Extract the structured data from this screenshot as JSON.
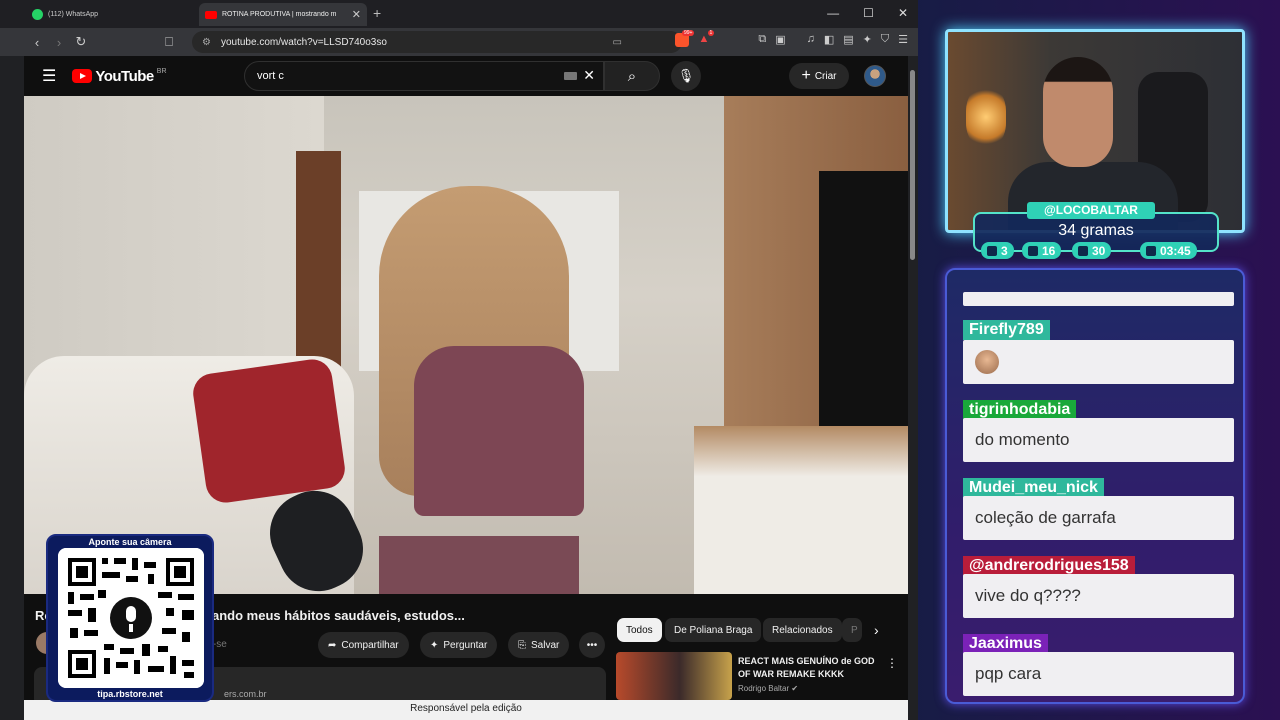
{
  "browser": {
    "tabs": [
      {
        "label": "(112) WhatsApp"
      },
      {
        "label": "ROTINA PRODUTIVA | mostrando m"
      }
    ],
    "url": "youtube.com/watch?v=LLSD740o3so",
    "status_text": "Responsável pela edição",
    "brave_badge": "99+",
    "alert_badge": "1"
  },
  "youtube": {
    "logo_text": "YouTube",
    "region": "BR",
    "search_value": "vort c",
    "create_label": "Criar",
    "video_title": "ando meus hábitos saudáveis, estudos...",
    "title_prefix": "Ro",
    "subscribe_faded": "er-se",
    "actions": {
      "share": "Compartilhar",
      "ask": "Perguntar",
      "save": "Salvar"
    },
    "description_url": "ers.com.br",
    "chips": [
      "Todos",
      "De Poliana Braga",
      "Relacionados",
      "P"
    ],
    "recommendation": {
      "title": "REACT MAIS GENUÍNO de GOD OF WAR REMAKE KKKK",
      "channel": "Rodrigo Baltar"
    }
  },
  "qr": {
    "top_text": "Aponte sua câmera",
    "bottom_text": "tipa.rbstore.net"
  },
  "stream": {
    "handle": "@LOCOBALTAR",
    "counter": "34 gramas",
    "stats": {
      "twitch": "3",
      "youtube": "16",
      "kick": "30",
      "time": "03:45"
    }
  },
  "chat": [
    {
      "user": "Firefly789",
      "message": ""
    },
    {
      "user": "tigrinhodabia",
      "message": "do momento"
    },
    {
      "user": "Mudei_meu_nick",
      "message": "coleção de garrafa"
    },
    {
      "user": "@andrerodrigues158",
      "message": "vive do q????"
    },
    {
      "user": "Jaaximus",
      "message": "pqp cara"
    }
  ],
  "colors": {
    "youtube_red": "#ff0000",
    "stream_accent": "#2fd1b6",
    "chat_user_teal": "#2fb89c",
    "chat_user_green": "#19a83a",
    "chat_user_red": "#b91d3a",
    "chat_user_purple": "#7b22b8"
  }
}
